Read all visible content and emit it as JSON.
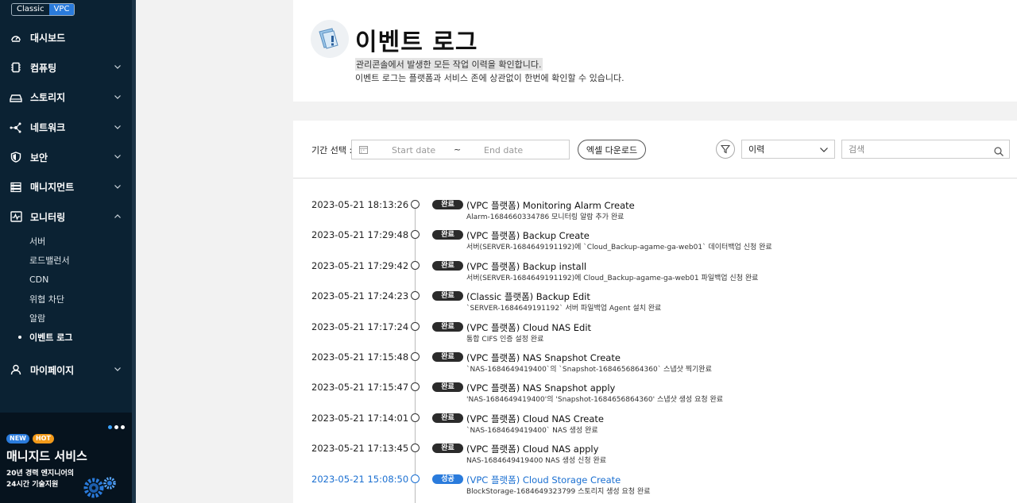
{
  "sidebar": {
    "env_classic": "Classic",
    "env_vpc": "VPC",
    "items": [
      {
        "label": "대시보드",
        "icon": "dashboard-icon",
        "chevron": false
      },
      {
        "label": "컴퓨팅",
        "icon": "server-icon",
        "chevron": true
      },
      {
        "label": "스토리지",
        "icon": "storage-icon",
        "chevron": true
      },
      {
        "label": "네트워크",
        "icon": "network-icon",
        "chevron": true
      },
      {
        "label": "보안",
        "icon": "shield-icon",
        "chevron": true
      },
      {
        "label": "매니지먼트",
        "icon": "management-icon",
        "chevron": true
      },
      {
        "label": "모니터링",
        "icon": "monitoring-icon",
        "chevron": true,
        "expanded": true
      }
    ],
    "monitoring_sub": [
      "서버",
      "로드밸런서",
      "CDN",
      "위협 차단",
      "알람",
      "이벤트 로그"
    ],
    "mypage": {
      "label": "마이페이지",
      "icon": "user-icon"
    },
    "promo": {
      "badge_new": "NEW",
      "badge_hot": "HOT",
      "title": "매니지드 서비스",
      "desc_line1": "20년 경력 엔지니어의",
      "desc_line2": "24시간 기술지원"
    }
  },
  "header": {
    "title": "이벤트 로그",
    "desc1": "관리콘솔에서 발생한 모든 작업 이력을 확인합니다.",
    "desc2": "이벤트 로그는 플랫폼과 서비스 존에 상관없이 한번에 확인할 수 있습니다."
  },
  "toolbar": {
    "period_label": "기간 선택 :",
    "start_placeholder": "Start date",
    "tilde": "~",
    "end_placeholder": "End date",
    "excel_label": "엑셀 다운로드",
    "select_value": "이력",
    "search_placeholder": "검색"
  },
  "events": [
    {
      "time": "2023-05-21 18:13:26",
      "status": "완료",
      "title": "(VPC 플랫폼) Monitoring Alarm Create",
      "detail": "Alarm-1684660334786 모니터링 알람 추가 완료",
      "kind": "done"
    },
    {
      "time": "2023-05-21 17:29:48",
      "status": "완료",
      "title": "(VPC 플랫폼) Backup Create",
      "detail": "서버(SERVER-1684649191192)에 `Cloud_Backup-agame-ga-web01` 데이터백업 신청 완료",
      "kind": "done"
    },
    {
      "time": "2023-05-21 17:29:42",
      "status": "완료",
      "title": "(VPC 플랫폼) Backup install",
      "detail": "서버(SERVER-1684649191192)에 Cloud_Backup-agame-ga-web01 파일백업 신청 완료",
      "kind": "done"
    },
    {
      "time": "2023-05-21 17:24:23",
      "status": "완료",
      "title": "(Classic 플랫폼) Backup Edit",
      "detail": "`SERVER-1684649191192` 서버 파일백업 Agent 설치 완료",
      "kind": "done"
    },
    {
      "time": "2023-05-21 17:17:24",
      "status": "완료",
      "title": "(VPC 플랫폼) Cloud NAS Edit",
      "detail": "통합 CIFS 인증 설정 완료",
      "kind": "done"
    },
    {
      "time": "2023-05-21 17:15:48",
      "status": "완료",
      "title": "(VPC 플랫폼) NAS Snapshot Create",
      "detail": "`NAS-1684649419400`의 `Snapshot-1684656864360` 스냅샷 찍기완료",
      "kind": "done"
    },
    {
      "time": "2023-05-21 17:15:47",
      "status": "완료",
      "title": "(VPC 플랫폼) NAS Snapshot apply",
      "detail": "'NAS-1684649419400'의 'Snapshot-1684656864360' 스냅샷 생성 요청 완료",
      "kind": "done"
    },
    {
      "time": "2023-05-21 17:14:01",
      "status": "완료",
      "title": "(VPC 플랫폼) Cloud NAS Create",
      "detail": "`NAS-1684649419400` NAS 생성 완료",
      "kind": "done"
    },
    {
      "time": "2023-05-21 17:13:45",
      "status": "완료",
      "title": "(VPC 플랫폼) Cloud NAS apply",
      "detail": "NAS-1684649419400 NAS 생성 신청 완료",
      "kind": "done"
    },
    {
      "time": "2023-05-21 15:08:50",
      "status": "성공",
      "title": "(VPC 플랫폼) Cloud Storage Create",
      "detail": "BlockStorage-1684649323799 스토리지 생성 요청 완료",
      "kind": "success"
    }
  ],
  "colors": {
    "sidebar_bg": "#0b2233",
    "accent": "#2a7bdc",
    "done_badge": "#2b2b2b",
    "success_text": "#1a6fd1"
  }
}
